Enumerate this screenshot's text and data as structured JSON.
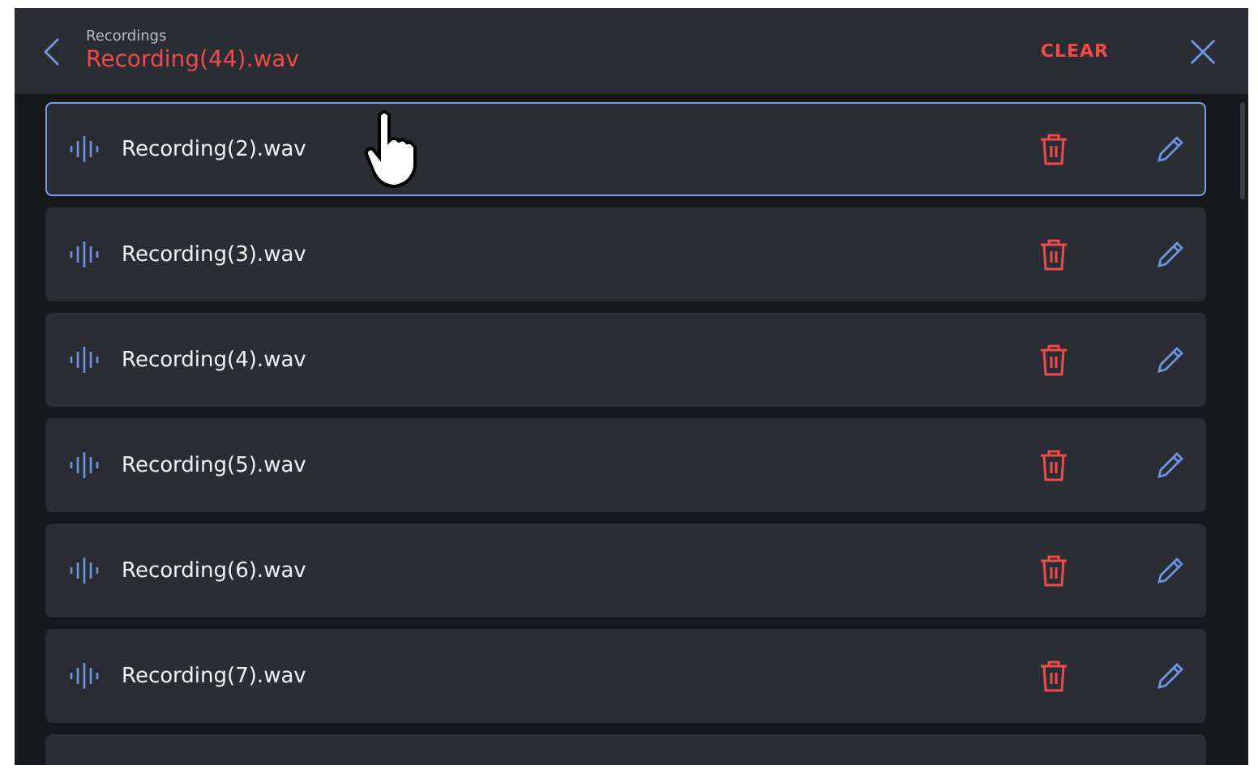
{
  "header": {
    "subtitle": "Recordings",
    "title": "Recording(44).wav",
    "clear_label": "CLEAR"
  },
  "recordings": [
    {
      "name": "Recording(2).wav",
      "selected": true
    },
    {
      "name": "Recording(3).wav",
      "selected": false
    },
    {
      "name": "Recording(4).wav",
      "selected": false
    },
    {
      "name": "Recording(5).wav",
      "selected": false
    },
    {
      "name": "Recording(6).wav",
      "selected": false
    },
    {
      "name": "Recording(7).wav",
      "selected": false
    }
  ]
}
